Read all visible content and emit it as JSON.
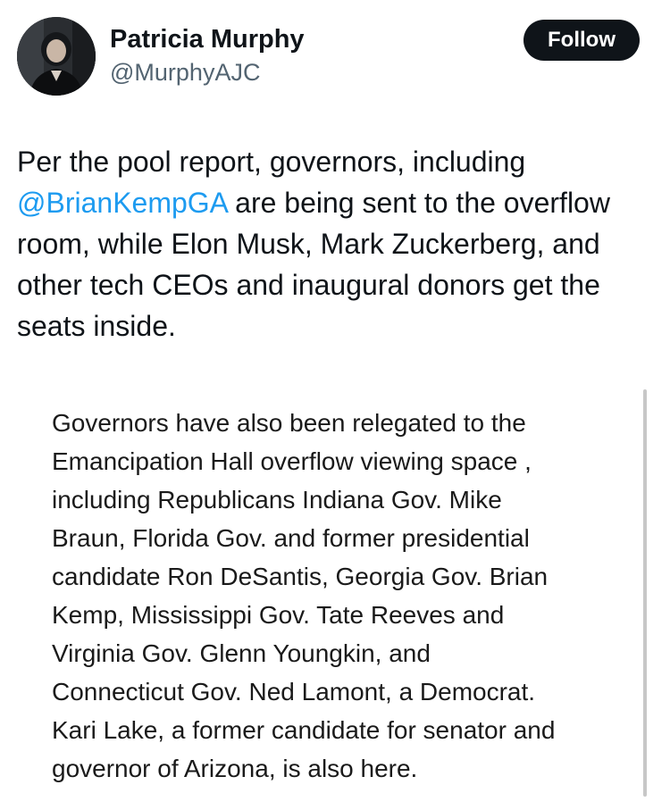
{
  "author": {
    "display_name": "Patricia Murphy",
    "handle": "@MurphyAJC"
  },
  "follow_button": {
    "label": "Follow"
  },
  "tweet": {
    "lines": [
      {
        "text": "Per the pool report, governors, including"
      },
      {
        "mention": "@BrianKempGA",
        "text": " are being sent to the overflow"
      },
      {
        "text": "room, while Elon Musk, Mark Zuckerberg, and"
      },
      {
        "text": "other tech CEOs and inaugural donors get the"
      },
      {
        "text": "seats inside."
      }
    ]
  },
  "quote": {
    "lines": [
      "Governors have also been relegated to the",
      "Emancipation Hall overflow viewing space ,",
      "including Republicans Indiana Gov. Mike",
      "Braun, Florida Gov. and former presidential",
      "candidate Ron DeSantis, Georgia Gov. Brian",
      "Kemp, Mississippi Gov. Tate Reeves and",
      "Virginia Gov. Glenn Youngkin, and",
      "Connecticut Gov. Ned Lamont, a Democrat.",
      "Kari Lake, a former candidate for senator and",
      "governor of Arizona, is also here."
    ]
  },
  "colors": {
    "mention": "#1d9bf0",
    "follow_bg": "#0f1419",
    "handle": "#536471"
  }
}
